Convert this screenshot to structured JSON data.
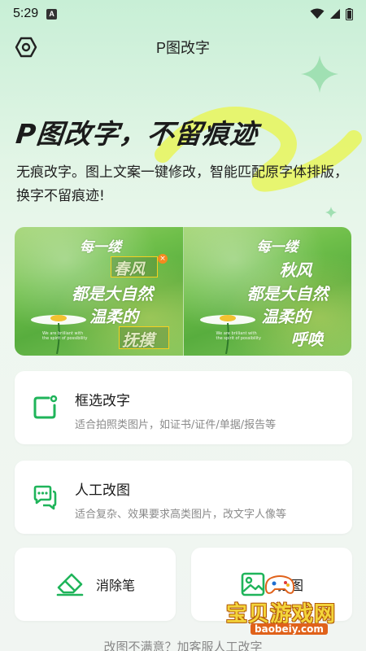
{
  "status_bar": {
    "time": "5:29",
    "notification_glyph": "A"
  },
  "app_bar": {
    "title": "P图改字",
    "settings_icon": "hexagon-settings-icon"
  },
  "hero": {
    "headline": "P图改字，不留痕迹",
    "subtitle": "无痕改字。图上文案一键修改，智能匹配原字体排版，换字不留痕迹!"
  },
  "demo": {
    "before": {
      "line1": "每一缕",
      "line2": "春风",
      "line3": "都是大自然",
      "line4": "温柔的",
      "line5": "抚摸"
    },
    "after": {
      "line1": "每一缕",
      "line2": "秋风",
      "line3": "都是大自然",
      "line4": "温柔的",
      "line5": "呼唤"
    }
  },
  "features": [
    {
      "title": "框选改字",
      "desc": "适合拍照类图片，如证书/证件/单据/报告等",
      "icon": "select-box-icon"
    },
    {
      "title": "人工改图",
      "desc": "适合复杂、效果要求高类图片，改文字人像等",
      "icon": "chat-bubble-icon"
    }
  ],
  "tools": [
    {
      "label": "消除笔",
      "icon": "eraser-icon"
    },
    {
      "label": "抠图",
      "icon": "image-icon"
    }
  ],
  "footer": "改图不满意？加客服人工改字",
  "watermark": {
    "text": "宝贝游戏网",
    "url": "baobeiy.com"
  },
  "colors": {
    "accent": "#1fb45a",
    "headline_highlight": "#e8f55a",
    "background_top": "#c8efd6"
  }
}
